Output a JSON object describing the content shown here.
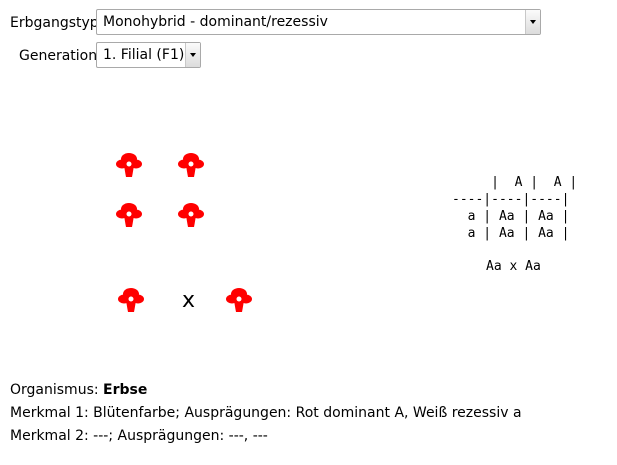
{
  "controls": {
    "erbgangstyp_label": "Erbgangstyp:",
    "erbgangstyp_value": "Monohybrid - dominant/rezessiv",
    "generation_label": "Generation:",
    "generation_value": "1. Filial (F1)"
  },
  "flower": {
    "color": "#ff0000",
    "center_color": "#ffffff",
    "icon": "flower-icon"
  },
  "cross_symbol": "x",
  "punnett": {
    "lines": [
      "     |  A |  A |",
      "----|----|----|",
      "  a | Aa | Aa |",
      "  a | Aa | Aa |"
    ],
    "cross": "Aa x Aa"
  },
  "info": {
    "organism_label": "Organismus:",
    "organism_value": "Erbse",
    "merkmal1": "Merkmal 1: Blütenfarbe; Ausprägungen: Rot dominant A, Weiß rezessiv a",
    "merkmal2": "Merkmal 2: ---; Ausprägungen: ---, ---"
  }
}
